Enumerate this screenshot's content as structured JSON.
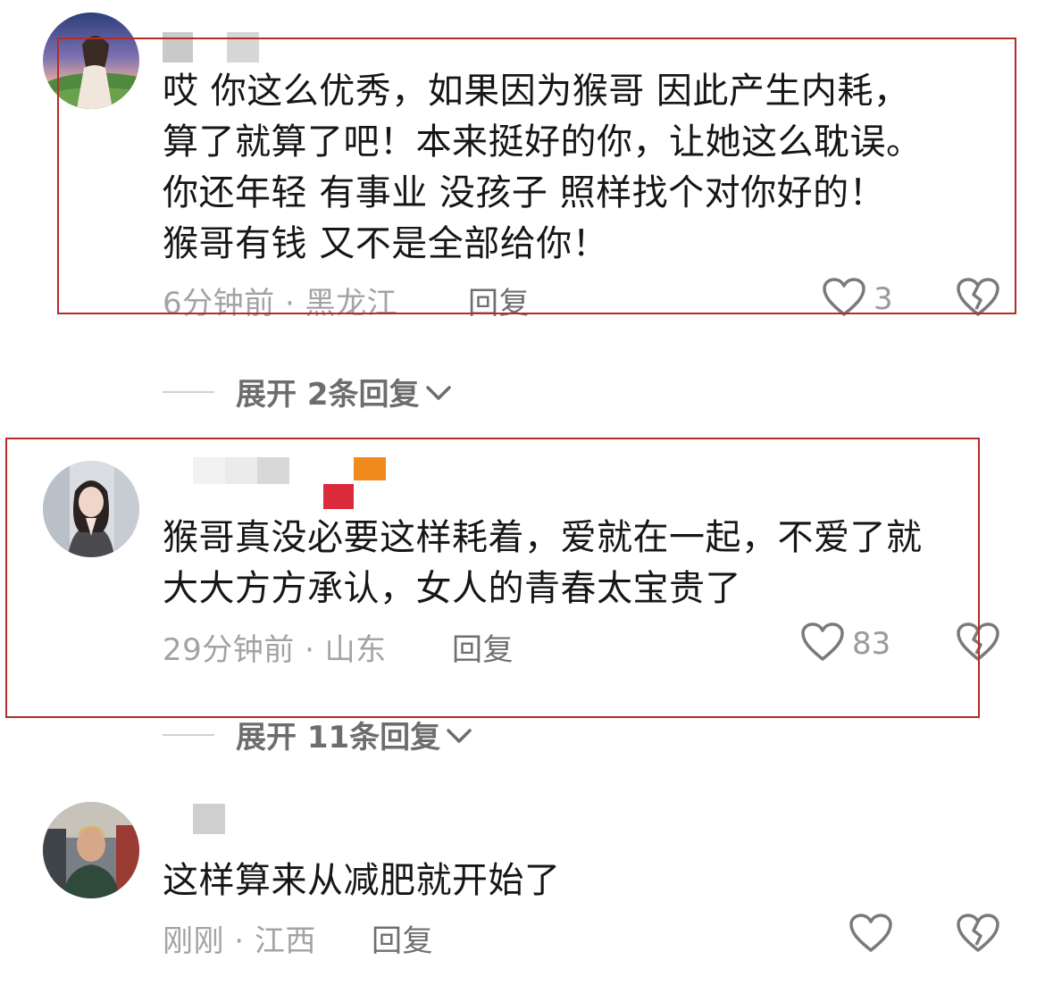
{
  "comments": [
    {
      "text": "哎 你这么优秀，如果因为猴哥 因此产生内耗，\n算了就算了吧！本来挺好的你，让她这么耽误。\n你还年轻 有事业 没孩子 照样找个对你好的！\n猴哥有钱 又不是全部给你！",
      "meta": "6分钟前 · 黑龙江",
      "reply_label": "回复",
      "likes": "3",
      "expand_label": "展开 2条回复"
    },
    {
      "text": "猴哥真没必要这样耗着，爱就在一起，不爱了就\n大大方方承认，女人的青春太宝贵了",
      "meta": "29分钟前 · 山东",
      "reply_label": "回复",
      "likes": "83",
      "expand_label": "展开 11条回复"
    },
    {
      "text": "这样算来从减肥就开始了",
      "meta": "刚刚 · 江西",
      "reply_label": "回复",
      "likes": ""
    }
  ],
  "icons": {
    "like": "heart-outline-icon",
    "dislike": "broken-heart-icon",
    "expand": "chevron-down-icon"
  },
  "colors": {
    "highlight_border": "#b62b2b",
    "meta_gray": "#a3a3a3",
    "icon_gray": "#7a7a7a"
  }
}
